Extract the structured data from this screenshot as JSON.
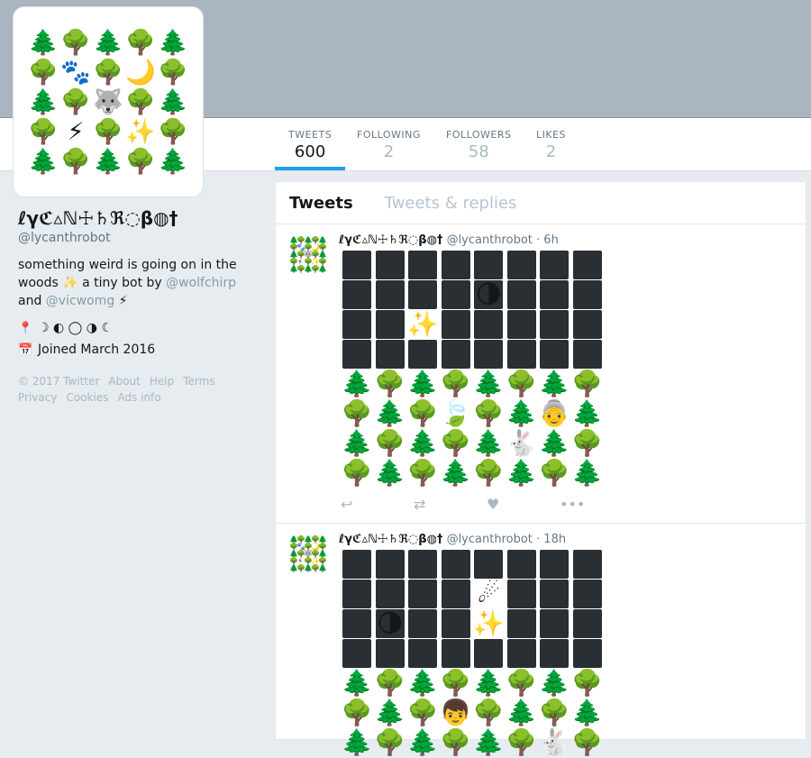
{
  "colors": {
    "accent": "#1da1f2",
    "cover": "#a9b6c1",
    "tile": "#292f33",
    "link": "#8899a6"
  },
  "avatar_grid": [
    [
      "🌲",
      "🌳",
      "🌲",
      "🌳",
      "🌲"
    ],
    [
      "🌳",
      "🐾",
      "🌳",
      "🌙",
      "🌳"
    ],
    [
      "🌲",
      "🌳",
      "🐺",
      "🌳",
      "🌲"
    ],
    [
      "🌳",
      "⚡",
      "🌳",
      "✨",
      "🌳"
    ],
    [
      "🌲",
      "🌳",
      "🌲",
      "🌳",
      "🌲"
    ]
  ],
  "nav": {
    "stats": [
      {
        "label": "TWEETS",
        "value": "600"
      },
      {
        "label": "FOLLOWING",
        "value": "2"
      },
      {
        "label": "FOLLOWERS",
        "value": "58"
      },
      {
        "label": "LIKES",
        "value": "2"
      }
    ]
  },
  "profile": {
    "name": "ℓγℭ▵ℕ☩♄ℜ◌β◍†",
    "handle": "@lycanthrobot",
    "bio_1": "something weird is going on in the woods ✨ a tiny bot by ",
    "bio_link1": "@wolfchirp",
    "bio_2": " and ",
    "bio_link2": "@vicwomg",
    "bio_3": " ⚡",
    "location": "☽ ◐ ◯ ◑ ☾",
    "joined": "Joined March 2016"
  },
  "footer": {
    "items": [
      "© 2017 Twitter",
      "About",
      "Help",
      "Terms",
      "Privacy",
      "Cookies",
      "Ads info"
    ]
  },
  "timeline": {
    "tab_tweets": "Tweets",
    "tab_replies": "Tweets & replies"
  },
  "tweets": [
    {
      "name": "ℓγℭ▵ℕ☩♄ℜ◌β◍†",
      "handle": "@lycanthrobot",
      "time": "6h",
      "grid": [
        [
          "B",
          "B",
          "B",
          "B",
          "B",
          "B",
          "B",
          "B"
        ],
        [
          "B",
          "B",
          "B",
          "B",
          "B🌗",
          "B",
          "B",
          "B"
        ],
        [
          "B",
          "B",
          "✨",
          "B",
          "B",
          "B",
          "B",
          "B"
        ],
        [
          "B",
          "B",
          "B",
          "B",
          "B",
          "B",
          "B",
          "B"
        ],
        [
          "🌲",
          "🌳",
          "🌲",
          "🌳",
          "🌲",
          "🌳",
          "🌲",
          "🌳"
        ],
        [
          "🌳",
          "🌲",
          "🌳",
          "🍃",
          "🌳",
          "🌲",
          "👵",
          "🌲"
        ],
        [
          "🌲",
          "🌳",
          "🌲",
          "🌳",
          "🌲",
          "🐇",
          "🌲",
          "🌳"
        ],
        [
          "🌳",
          "🌲",
          "🌳",
          "🌲",
          "🌳",
          "🌲",
          "🌳",
          "🌲"
        ]
      ]
    },
    {
      "name": "ℓγℭ▵ℕ☩♄ℜ◌β◍†",
      "handle": "@lycanthrobot",
      "time": "18h",
      "grid": [
        [
          "B",
          "B",
          "B",
          "B",
          "B",
          "B",
          "B",
          "B"
        ],
        [
          "B",
          "B",
          "B",
          "B",
          "☄",
          "B",
          "B",
          "B"
        ],
        [
          "B",
          "B🌗",
          "B",
          "B",
          "✨",
          "B",
          "B",
          "B"
        ],
        [
          "B",
          "B",
          "B",
          "B",
          "B",
          "B",
          "B",
          "B"
        ],
        [
          "🌲",
          "🌳",
          "🌲",
          "🌳",
          "🌲",
          "🌳",
          "🌲",
          "🌳"
        ],
        [
          "🌳",
          "🌲",
          "🌳",
          "👦",
          "🌳",
          "🌲",
          "🌳",
          "🌲"
        ],
        [
          "🌲",
          "🌳",
          "🌲",
          "🌳",
          "🌲",
          "🌳",
          "🐇",
          "🌳"
        ]
      ]
    }
  ]
}
